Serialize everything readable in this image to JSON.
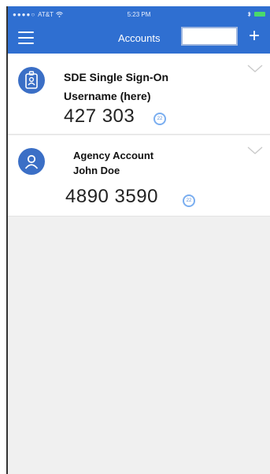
{
  "status_bar": {
    "signal_dots": "●●●●○",
    "carrier": "AT&T",
    "time": "5:23 PM"
  },
  "nav": {
    "title": "Accounts",
    "add_label": "+"
  },
  "accounts": [
    {
      "name": "SDE Single Sign-On",
      "user": "Username (here)",
      "code": "427 303",
      "timer": "22",
      "icon": "badge-icon"
    },
    {
      "name": "Agency Account",
      "user": "John Doe",
      "code": "4890 3590",
      "timer": "22",
      "icon": "user-icon"
    }
  ],
  "colors": {
    "brand": "#2f6fd1",
    "avatar": "#3b6fc6",
    "timer": "#7aaef0"
  }
}
